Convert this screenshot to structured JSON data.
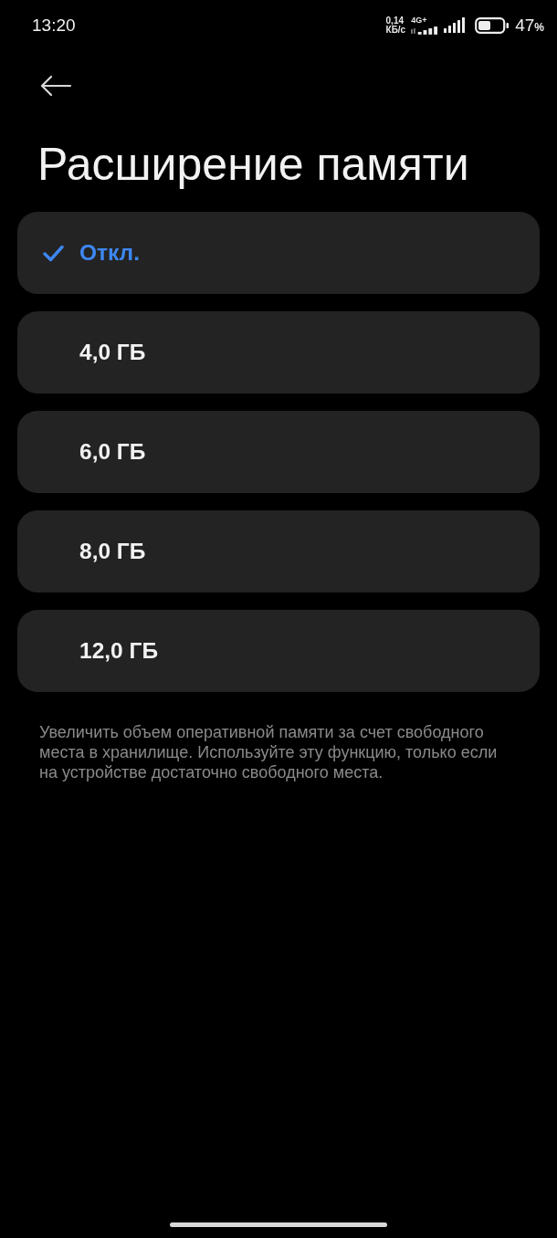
{
  "status_bar": {
    "time": "13:20",
    "speed_value": "0,14",
    "speed_unit": "КБ/с",
    "network": "4G+",
    "battery_percent": "47",
    "percent_sign": "%"
  },
  "header": {
    "title": "Расширение памяти"
  },
  "options": [
    {
      "label": "Откл.",
      "selected": true
    },
    {
      "label": "4,0 ГБ",
      "selected": false
    },
    {
      "label": "6,0 ГБ",
      "selected": false
    },
    {
      "label": "8,0 ГБ",
      "selected": false
    },
    {
      "label": "12,0 ГБ",
      "selected": false
    }
  ],
  "description": "Увеличить объем оперативной памяти за счет свободного места в хранилище. Используйте эту функцию, только если на устройстве достаточно свободного места."
}
